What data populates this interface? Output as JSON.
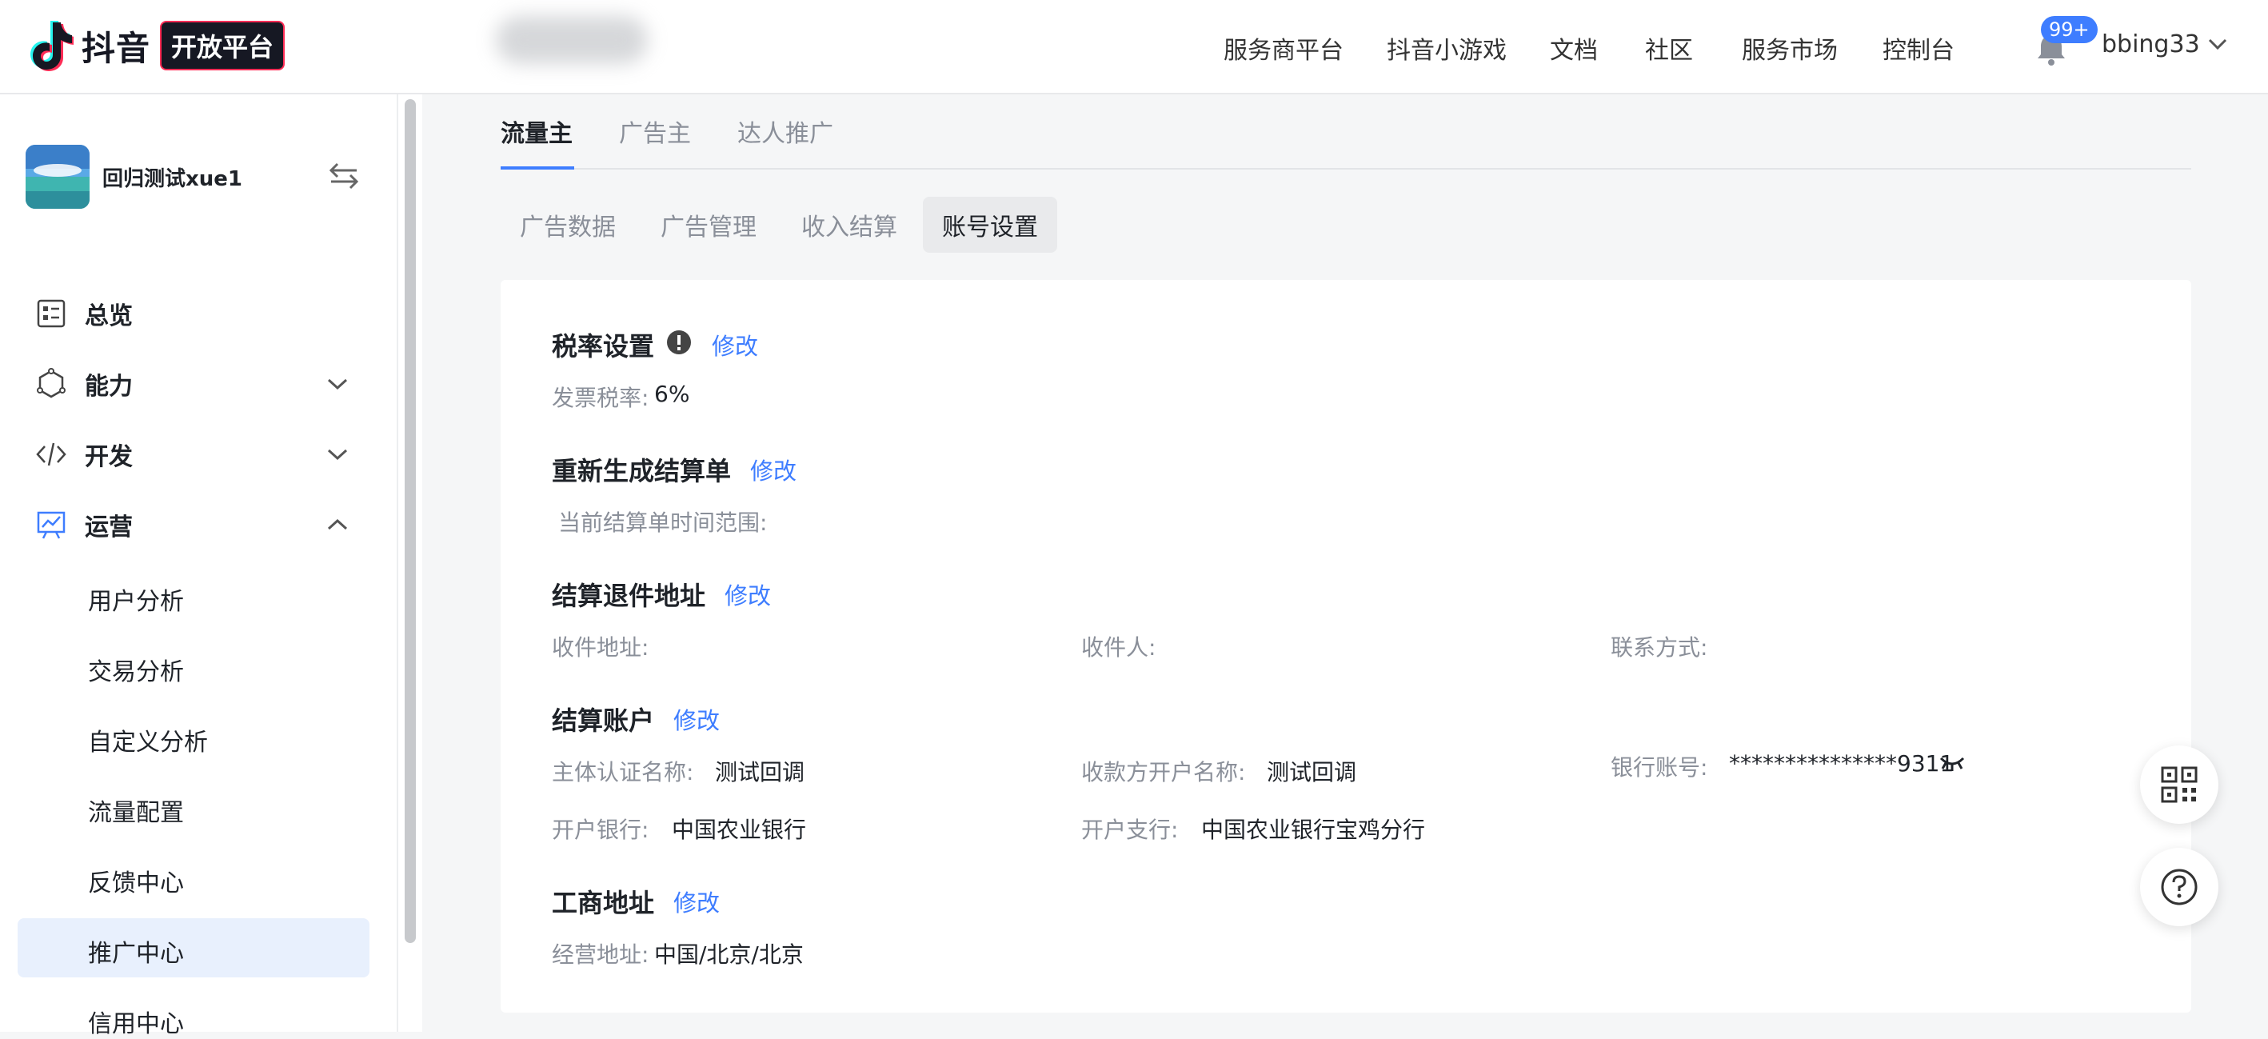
{
  "header": {
    "logo_text": "抖音",
    "logo_badge": "开放平台",
    "nav": [
      "服务商平台",
      "抖音小游戏",
      "文档",
      "社区",
      "服务市场",
      "控制台"
    ],
    "notification_count": "99+",
    "username": "bbing33"
  },
  "sidebar": {
    "app_name": "回归测试xue1",
    "menu": {
      "overview": "总览",
      "ability": "能力",
      "develop": "开发",
      "operation": "运营"
    },
    "sub_items": [
      "用户分析",
      "交易分析",
      "自定义分析",
      "流量配置",
      "反馈中心",
      "推广中心",
      "信用中心"
    ]
  },
  "main": {
    "top_tabs": [
      "流量主",
      "广告主",
      "达人推广"
    ],
    "sub_tabs": [
      "广告数据",
      "广告管理",
      "收入结算",
      "账号设置"
    ]
  },
  "sections": {
    "tax": {
      "title": "税率设置",
      "edit": "修改",
      "rate_label": "发票税率:",
      "rate_value": "6%"
    },
    "regen": {
      "title": "重新生成结算单",
      "edit": "修改",
      "range_label": "当前结算单时间范围:"
    },
    "return_addr": {
      "title": "结算退件地址",
      "edit": "修改",
      "address_label": "收件地址:",
      "receiver_label": "收件人:",
      "contact_label": "联系方式:"
    },
    "account": {
      "title": "结算账户",
      "edit": "修改",
      "entity_label": "主体认证名称:",
      "entity_value": "测试回调",
      "payee_label": "收款方开户名称:",
      "payee_value": "测试回调",
      "bank_account_label": "银行账号:",
      "bank_account_value": "***************9311",
      "bank_label": "开户银行:",
      "bank_value": "中国农业银行",
      "branch_label": "开户支行:",
      "branch_value": "中国农业银行宝鸡分行"
    },
    "business_addr": {
      "title": "工商地址",
      "edit": "修改",
      "addr_label": "经营地址:",
      "addr_value": "中国/北京/北京"
    }
  },
  "colors": {
    "accent": "#3e7dff",
    "active_bg": "#e8f0fd"
  }
}
